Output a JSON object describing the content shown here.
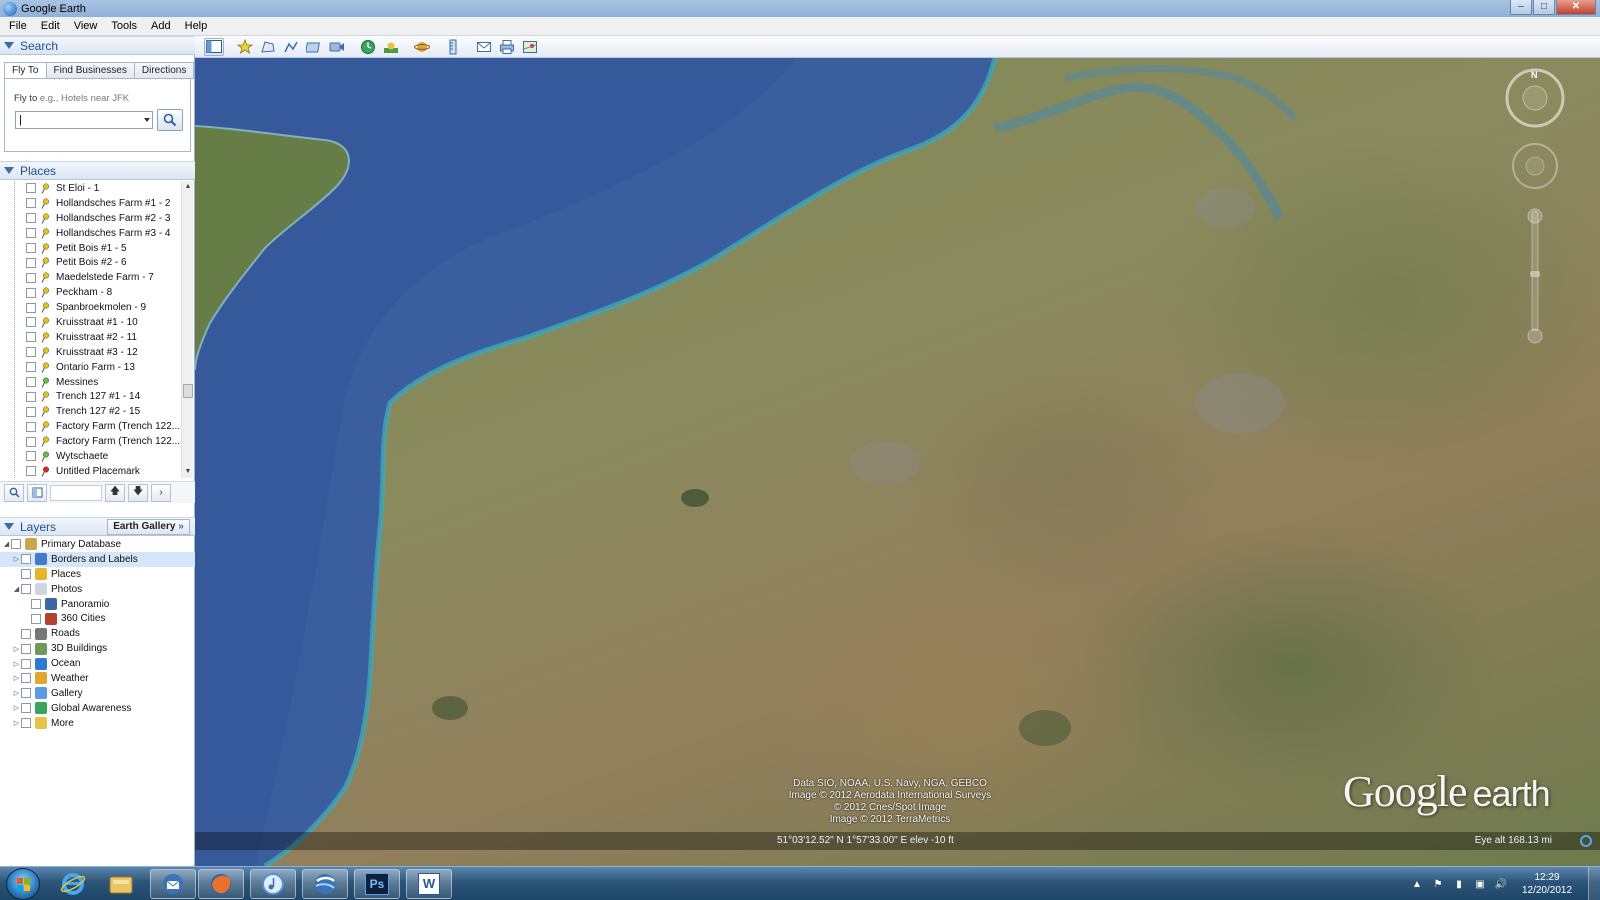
{
  "window": {
    "title": "Google Earth",
    "controls": [
      "–",
      "□",
      "✕"
    ]
  },
  "menu": [
    "File",
    "Edit",
    "View",
    "Tools",
    "Add",
    "Help"
  ],
  "search": {
    "header": "Search",
    "tabs": [
      "Fly To",
      "Find Businesses",
      "Directions"
    ],
    "flyto_label": "Fly to",
    "flyto_hint": "e.g., Hotels near JFK",
    "input_value": "|"
  },
  "places": {
    "header": "Places",
    "items": [
      {
        "label": "St Eloi - 1",
        "pin": "#e2c21b"
      },
      {
        "label": "Hollandsches Farm #1 - 2",
        "pin": "#e2c21b"
      },
      {
        "label": "Hollandsches Farm #2 - 3",
        "pin": "#e2c21b"
      },
      {
        "label": "Hollandsches Farm #3 - 4",
        "pin": "#e2c21b"
      },
      {
        "label": "Petit Bois #1 - 5",
        "pin": "#e2c21b"
      },
      {
        "label": "Petit Bois #2 - 6",
        "pin": "#e2c21b"
      },
      {
        "label": "Maedelstede Farm - 7",
        "pin": "#e2c21b"
      },
      {
        "label": "Peckham - 8",
        "pin": "#e2c21b"
      },
      {
        "label": "Spanbroekmolen - 9",
        "pin": "#e2c21b"
      },
      {
        "label": "Kruisstraat #1 - 10",
        "pin": "#e2c21b"
      },
      {
        "label": "Kruisstraat #2 - 11",
        "pin": "#e2c21b"
      },
      {
        "label": "Kruisstraat #3 - 12",
        "pin": "#e2c21b"
      },
      {
        "label": "Ontario Farm - 13",
        "pin": "#e2c21b"
      },
      {
        "label": "Messines",
        "pin": "#5bbf3a"
      },
      {
        "label": "Trench 127 #1 - 14",
        "pin": "#e2c21b"
      },
      {
        "label": "Trench 127 #2 - 15",
        "pin": "#e2c21b"
      },
      {
        "label": "Factory Farm (Trench 122...",
        "pin": "#e2c21b"
      },
      {
        "label": "Factory Farm (Trench 122...",
        "pin": "#e2c21b"
      },
      {
        "label": "Wytschaete",
        "pin": "#5bbf3a"
      },
      {
        "label": "Untitled Placemark",
        "pin": "#d6281e"
      }
    ]
  },
  "layers": {
    "header": "Layers",
    "gallery_button": "Earth Gallery",
    "items": [
      {
        "label": "Primary Database",
        "icon": "#c9a64a",
        "expander": "◢",
        "indent": 0,
        "selected": false
      },
      {
        "label": "Borders and Labels",
        "icon": "#3f7ccf",
        "expander": "▷",
        "indent": 1,
        "selected": true
      },
      {
        "label": "Places",
        "icon": "#e3b72c",
        "expander": "",
        "indent": 1,
        "selected": false
      },
      {
        "label": "Photos",
        "icon": "#cfd6df",
        "expander": "◢",
        "indent": 1,
        "selected": false
      },
      {
        "label": "Panoramio",
        "icon": "#3b66a8",
        "expander": "",
        "indent": 2,
        "selected": false
      },
      {
        "label": "360 Cities",
        "icon": "#b4432e",
        "expander": "",
        "indent": 2,
        "selected": false
      },
      {
        "label": "Roads",
        "icon": "#777777",
        "expander": "",
        "indent": 1,
        "selected": false
      },
      {
        "label": "3D Buildings",
        "icon": "#6c9c5b",
        "expander": "▷",
        "indent": 1,
        "selected": false
      },
      {
        "label": "Ocean",
        "icon": "#2f7ad1",
        "expander": "▷",
        "indent": 1,
        "selected": false
      },
      {
        "label": "Weather",
        "icon": "#e0a92c",
        "expander": "▷",
        "indent": 1,
        "selected": false
      },
      {
        "label": "Gallery",
        "icon": "#5b9be0",
        "expander": "▷",
        "indent": 1,
        "selected": false
      },
      {
        "label": "Global Awareness",
        "icon": "#3aa35c",
        "expander": "▷",
        "indent": 1,
        "selected": false
      },
      {
        "label": "More",
        "icon": "#e8c34a",
        "expander": "▷",
        "indent": 1,
        "selected": false
      }
    ]
  },
  "toolbar_icons": [
    "sidebar-toggle-icon",
    "add-placemark-icon",
    "add-polygon-icon",
    "add-path-icon",
    "add-image-overlay-icon",
    "record-tour-icon",
    "historical-imagery-icon",
    "sunlight-icon",
    "switch-planet-icon",
    "ruler-icon",
    "email-icon",
    "print-icon",
    "view-in-maps-icon"
  ],
  "map": {
    "attribution": [
      "Data SIO, NOAA, U.S. Navy, NGA, GEBCO",
      "Image © 2012 Aerodata International Surveys",
      "© 2012 Cnes/Spot Image",
      "Image © 2012 TerraMetrics"
    ],
    "logo_google": "Google",
    "logo_earth": "earth",
    "compass_north": "N",
    "coords": "51°03'12.52\" N   1°57'33.00\" E  elev   -10 ft",
    "eye_alt": "Eye alt   168.13 mi"
  },
  "taskbar": {
    "apps": [
      "internet-explorer-icon",
      "file-explorer-icon",
      "thunderbird-icon",
      "firefox-icon",
      "itunes-icon",
      "google-earth-icon",
      "photoshop-icon",
      "word-icon"
    ],
    "photoshop_label": "Ps",
    "word_label": "W",
    "time": "12:29",
    "date": "12/20/2012"
  }
}
